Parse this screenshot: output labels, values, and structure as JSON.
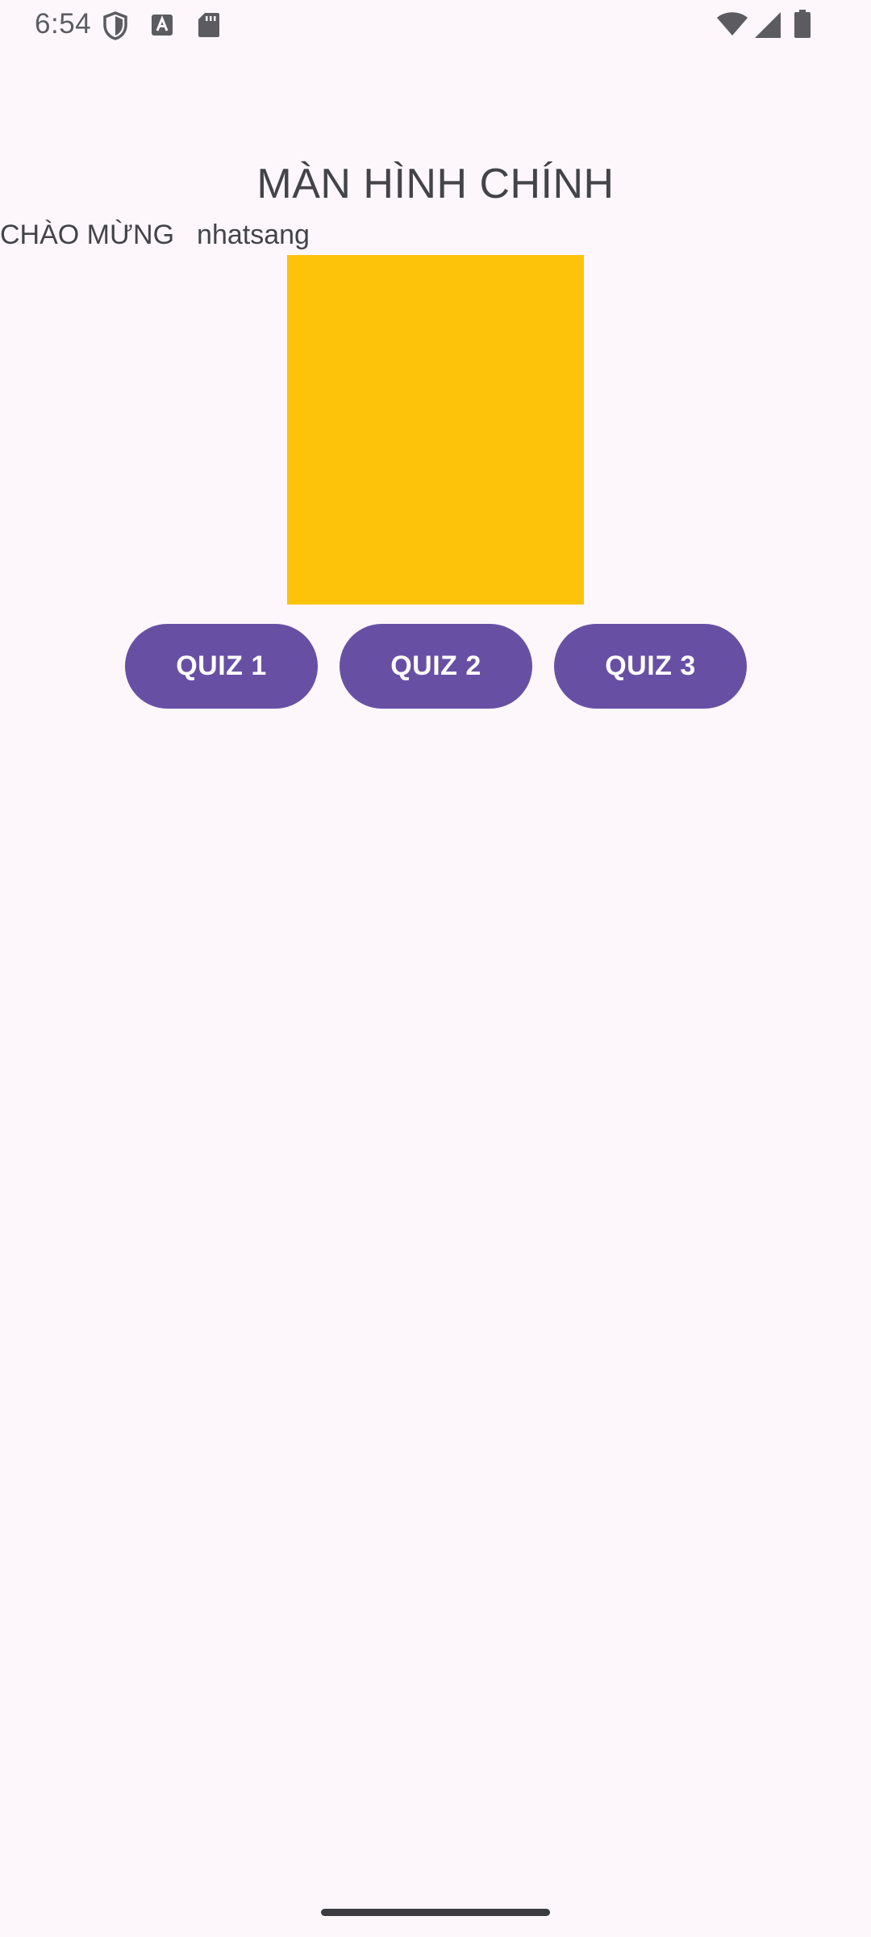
{
  "status_bar": {
    "time": "6:54",
    "icons": [
      "shield-icon",
      "font-icon",
      "sdcard-icon",
      "wifi-icon",
      "signal-icon",
      "battery-icon"
    ]
  },
  "main": {
    "title": "MÀN HÌNH CHÍNH",
    "welcome_label": "CHÀO MỪNG",
    "username": "nhatsang",
    "image_color": "#fdc20a",
    "buttons": [
      {
        "label": "QUIZ 1"
      },
      {
        "label": "QUIZ 2"
      },
      {
        "label": "QUIZ 3"
      }
    ]
  },
  "colors": {
    "background": "#fdf7fb",
    "accent": "#6750a4",
    "text": "#444448"
  }
}
